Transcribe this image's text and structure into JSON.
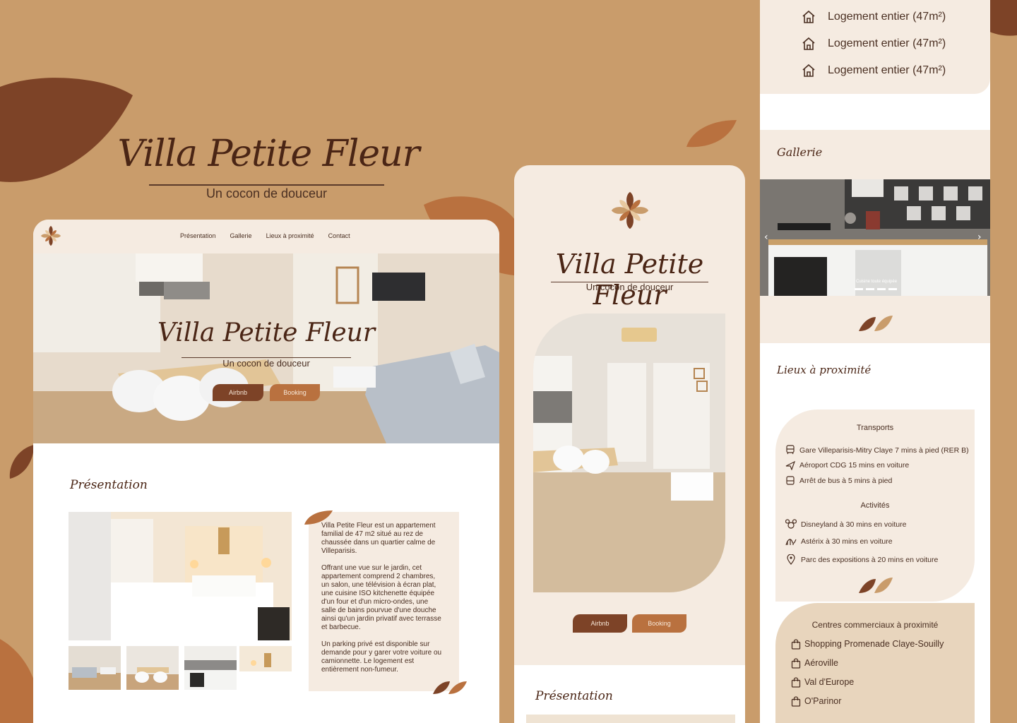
{
  "brand": {
    "name": "Villa Petite Fleur",
    "tagline": "Un cocon de douceur",
    "colors": {
      "background": "#c99c6b",
      "dark_brown": "#7d4327",
      "copper": "#b9713f",
      "cream": "#f5ebe1",
      "sand": "#e8d5bd"
    }
  },
  "desktop": {
    "nav": {
      "items": [
        "Présentation",
        "Gallerie",
        "Lieux à proximité",
        "Contact"
      ]
    },
    "hero": {
      "title": "Villa Petite Fleur",
      "subtitle": "Un cocon de douceur",
      "btn_airbnb": "Airbnb",
      "btn_booking": "Booking"
    },
    "presentation": {
      "title": "Présentation",
      "paragraphs": [
        "Villa Petite Fleur est un appartement familial de 47 m2 situé au rez de chaussée dans un quartier calme de Villeparisis.",
        "Offrant une vue sur le jardin, cet appartement comprend 2 chambres, un salon, une télévision à écran plat, une cuisine ISO kitchenette équipée d'un four et d'un micro-ondes, une salle de bains pourvue d'une douche ainsi qu'un jardin privatif avec terrasse et barbecue.",
        "Un parking privé est disponible sur demande pour y garer votre voiture ou camionnette. Le logement est entièrement non-fumeur."
      ]
    }
  },
  "mobile": {
    "title": "Villa Petite Fleur",
    "subtitle": "Un cocon de douceur",
    "btn_airbnb": "Airbnb",
    "btn_booking": "Booking",
    "presentation_title": "Présentation"
  },
  "rightcol": {
    "features": [
      "Logement entier (47m²)",
      "Logement entier (47m²)",
      "Logement entier (47m²)"
    ],
    "gallery_title": "Gallerie",
    "gallery_caption": "Cuisine toute équipée",
    "lieux_title": "Lieux à proximité",
    "transports_title": "Transports",
    "transports": [
      {
        "icon": "train-icon",
        "text": "Gare Villeparisis-Mitry Claye 7 mins à pied (RER B)"
      },
      {
        "icon": "plane-icon",
        "text": "Aéroport CDG 15 mins en voiture"
      },
      {
        "icon": "bus-icon",
        "text": "Arrêt de bus à 5 mins à pied"
      }
    ],
    "activites_title": "Activités",
    "activites": [
      {
        "icon": "mickey-icon",
        "text": "Disneyland à 30 mins en voiture"
      },
      {
        "icon": "rollercoaster-icon",
        "text": "Astérix à 30 mins en voiture"
      },
      {
        "icon": "pin-icon",
        "text": "Parc des expositions à 20 mins en voiture"
      }
    ],
    "centres_title": "Centres commerciaux à proximité",
    "centres": [
      "Shopping Promenade Claye-Souilly",
      "Aéroville",
      "Val d'Europe",
      "O'Parinor"
    ]
  }
}
